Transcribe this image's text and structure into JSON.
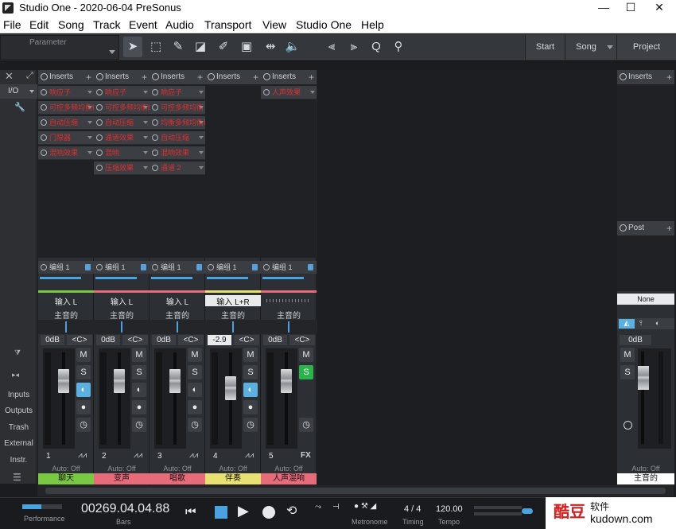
{
  "window": {
    "title": "Studio One - 2020-06-04 PreSonus",
    "minimize": "—",
    "maximize": "☐",
    "close": "✕"
  },
  "menu": [
    "File",
    "Edit",
    "Song",
    "Track",
    "Event",
    "Audio",
    "Transport",
    "View",
    "Studio One",
    "Help"
  ],
  "toolbar": {
    "parameter_label": "Parameter",
    "nav": {
      "start": "Start",
      "song": "Song",
      "project": "Project"
    }
  },
  "sidebar": {
    "io": "I/O",
    "items": [
      "Inputs",
      "Outputs",
      "Trash",
      "External",
      "Instr."
    ]
  },
  "inserts_label": "Inserts",
  "post_label": "Post",
  "channels": [
    {
      "inserts": [
        "响应子",
        "可控多频均衡EQ",
        "自动压缩",
        "门限器",
        "混响效果"
      ],
      "send": "编组 1",
      "input": "输入 L",
      "output": "主音的",
      "volume": "0dB",
      "pan": "<C>",
      "num": "1",
      "auto": "Auto: Off",
      "name": "聊天",
      "color": "#7ac943",
      "monitor": true,
      "solo": false,
      "fader": 0.76
    },
    {
      "inserts": [
        "响应子",
        "可控多频均衡EQ",
        "自动压缩",
        "通道效果",
        "混响",
        "压缩效果"
      ],
      "send": "编组 1",
      "input": "输入 L",
      "output": "主音的",
      "volume": "0dB",
      "pan": "<C>",
      "num": "2",
      "auto": "Auto: Off",
      "name": "变声",
      "color": "#e86b7a",
      "monitor": false,
      "solo": false,
      "fader": 0.76
    },
    {
      "inserts": [
        "响应子",
        "可控多频均衡",
        "均衡多频均衡EQ",
        "自动压缩",
        "混响效果",
        "通道 2"
      ],
      "send": "编组 1",
      "input": "输入 L",
      "output": "主音的",
      "volume": "0dB",
      "pan": "<C>",
      "num": "3",
      "auto": "Auto: Off",
      "name": "唱歌",
      "color": "#e86b7a",
      "monitor": false,
      "solo": false,
      "fader": 0.76
    },
    {
      "inserts": [],
      "send": "编组 1",
      "input": "输入 L+R",
      "output": "主音的",
      "volume": "-2.9",
      "pan": "<C>",
      "num": "4",
      "auto": "Auto: Off",
      "name": "伴奏",
      "color": "#e8e070",
      "monitor": true,
      "solo": false,
      "fader": 0.65
    },
    {
      "inserts": [
        "人声效果"
      ],
      "send": "编组 1",
      "input": "",
      "output": "主音的",
      "volume": "0dB",
      "pan": "<C>",
      "num": "5",
      "auto": "Auto: Off",
      "name": "人声混响",
      "color": "#e86b7a",
      "monitor": false,
      "solo": true,
      "fader": 0.76,
      "fx": "FX"
    }
  ],
  "master": {
    "input": "None",
    "volume": "0dB",
    "auto": "Auto: Off",
    "name": "主音的",
    "m": "M",
    "s": "S"
  },
  "transport": {
    "perf": "Performance",
    "time": "00269.04.04.88",
    "bars": "Bars",
    "metronome": "Metronome",
    "sig": "4 / 4",
    "timing": "Timing",
    "tempo": "120.00",
    "tempo_label": "Tempo"
  },
  "watermark": {
    "brand": "酷豆",
    "soft": "软件",
    "url": "kudown.com"
  },
  "colors": {
    "solo": "#2ab34b",
    "monitor": "#5ab0e0",
    "accent": "#4aa3e0"
  }
}
